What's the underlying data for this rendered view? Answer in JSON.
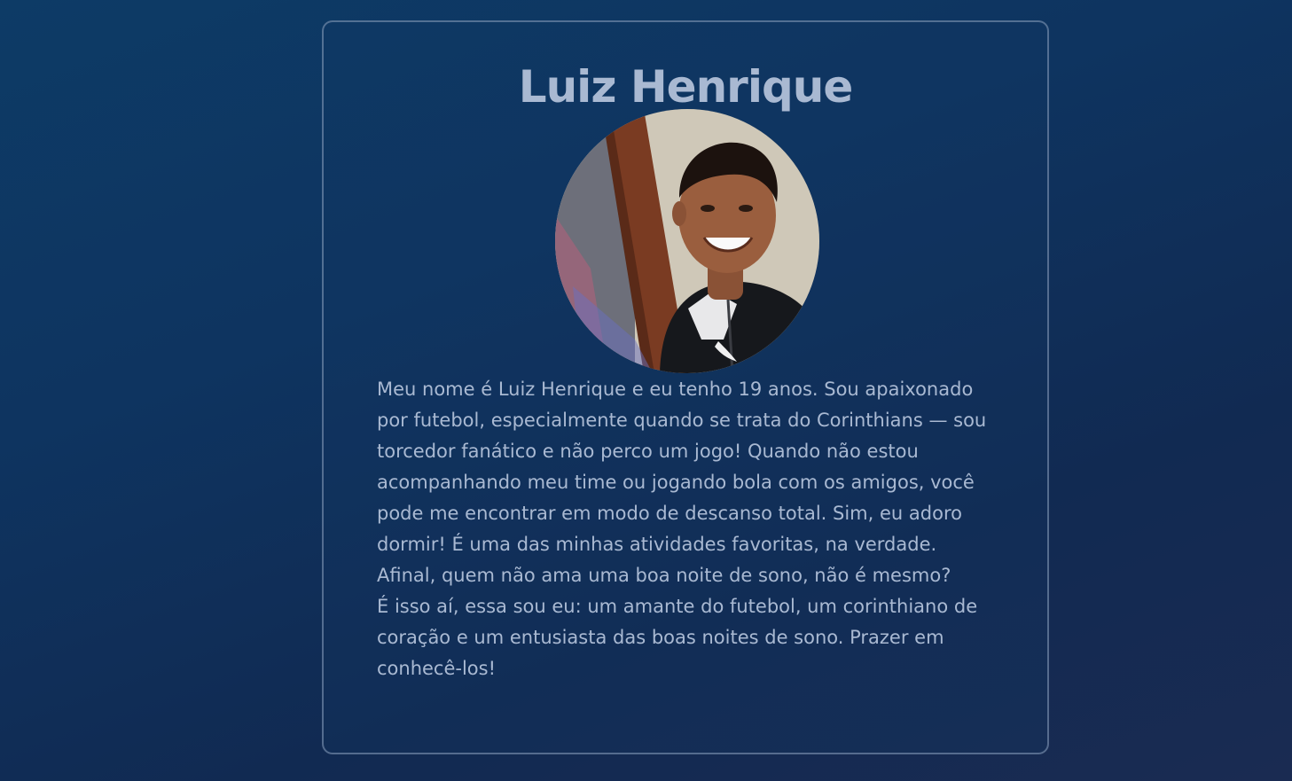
{
  "profile": {
    "name": "Luiz Henrique",
    "photo": "profile-photo",
    "bio": [
      "Meu nome é Luiz Henrique e eu tenho 19 anos. Sou apaixonado por futebol, especialmente quando se trata do Corinthians — sou torcedor fanático e não perco um jogo! Quando não estou acompanhando meu time ou jogando bola com os amigos, você pode me encontrar em modo de descanso total. Sim, eu adoro dormir! É uma das minhas atividades favoritas, na verdade. Afinal, quem não ama uma boa noite de sono, não é mesmo?",
      "É isso aí, essa sou eu: um amante do futebol, um corinthiano de coração e um entusiasta das boas noites de sono. Prazer em conhecê-los!"
    ]
  },
  "colors": {
    "background": "#0d3b66",
    "text": "#a9b9d2",
    "card_border": "#8ca0be"
  }
}
